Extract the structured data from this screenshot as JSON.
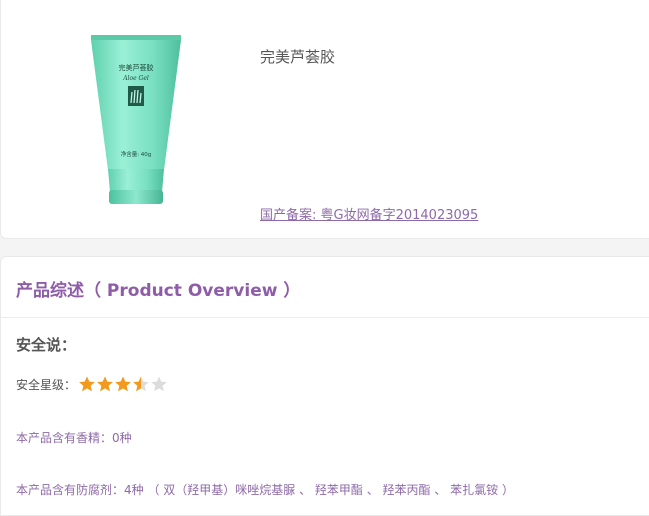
{
  "product": {
    "name": "完美芦荟胶",
    "tube_brand": "完美芦荟胶",
    "tube_subtitle": "Aloe Gel",
    "tube_net": "净含量: 40g",
    "record_link": "国产备案: 粤G妆网备字2014023095"
  },
  "overview": {
    "title": "产品综述（ Product Overview ）",
    "safety_title": "安全说：",
    "rating_label": "安全星级：",
    "rating_value": 3.5,
    "rating_max": 5,
    "fragrance_text": "本产品含有香精：0种",
    "preservative_text": "本产品含有防腐剂：4种 （ 双（羟甲基）咪唑烷基脲 、 羟苯甲酯 、 羟苯丙酯 、 苯扎氯铵 ）"
  },
  "colors": {
    "accent_purple": "#8e5da8",
    "link_purple": "#8e6aa8",
    "star_orange": "#f39a1c",
    "star_empty": "#dcdcdc",
    "tube_mint": "#7fe0c2"
  }
}
